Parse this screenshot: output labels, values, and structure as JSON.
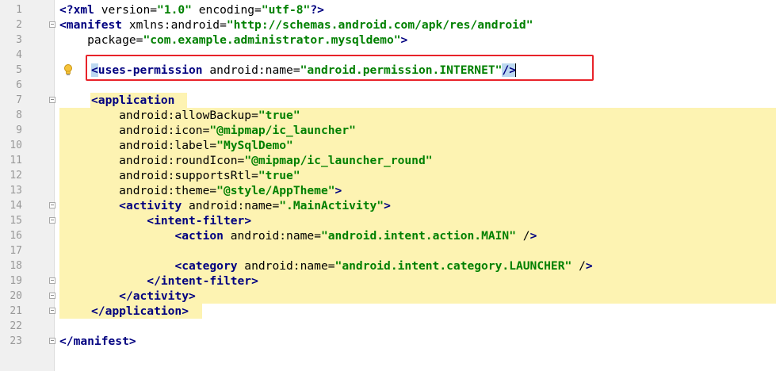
{
  "colors": {
    "gutter_bg": "#f0f0f0",
    "line_number": "#999999",
    "tag": "#000080",
    "attribute": "#0000ff",
    "value": "#008000",
    "scope_highlight": "#fdf3b2",
    "annotation_box": "#e8232a",
    "tag_match_highlight": "#bcd8f0"
  },
  "icons": {
    "intention_bulb": "lightbulb-icon",
    "fold": "fold-marker-icon"
  },
  "lines": [
    {
      "n": "1",
      "text": "<?xml version=\"1.0\" encoding=\"utf-8\"?>"
    },
    {
      "n": "2",
      "text": "<manifest xmlns:android=\"http://schemas.android.com/apk/res/android\""
    },
    {
      "n": "3",
      "text": "    package=\"com.example.administrator.mysqldemo\">"
    },
    {
      "n": "4",
      "text": ""
    },
    {
      "n": "5",
      "text": "<uses-permission android:name=\"android.permission.INTERNET\"/>"
    },
    {
      "n": "6",
      "text": ""
    },
    {
      "n": "7",
      "text": "<application"
    },
    {
      "n": "8",
      "text": "    android:allowBackup=\"true\""
    },
    {
      "n": "9",
      "text": "    android:icon=\"@mipmap/ic_launcher\""
    },
    {
      "n": "10",
      "text": "    android:label=\"MySqlDemo\""
    },
    {
      "n": "11",
      "text": "    android:roundIcon=\"@mipmap/ic_launcher_round\""
    },
    {
      "n": "12",
      "text": "    android:supportsRtl=\"true\""
    },
    {
      "n": "13",
      "text": "    android:theme=\"@style/AppTheme\">"
    },
    {
      "n": "14",
      "text": "    <activity android:name=\".MainActivity\">"
    },
    {
      "n": "15",
      "text": "        <intent-filter>"
    },
    {
      "n": "16",
      "text": "            <action android:name=\"android.intent.action.MAIN\" />"
    },
    {
      "n": "17",
      "text": ""
    },
    {
      "n": "18",
      "text": "            <category android:name=\"android.intent.category.LAUNCHER\" />"
    },
    {
      "n": "19",
      "text": "        </intent-filter>"
    },
    {
      "n": "20",
      "text": "    </activity>"
    },
    {
      "n": "21",
      "text": "</application>"
    },
    {
      "n": "22",
      "text": ""
    },
    {
      "n": "23",
      "text": "</manifest>"
    }
  ]
}
